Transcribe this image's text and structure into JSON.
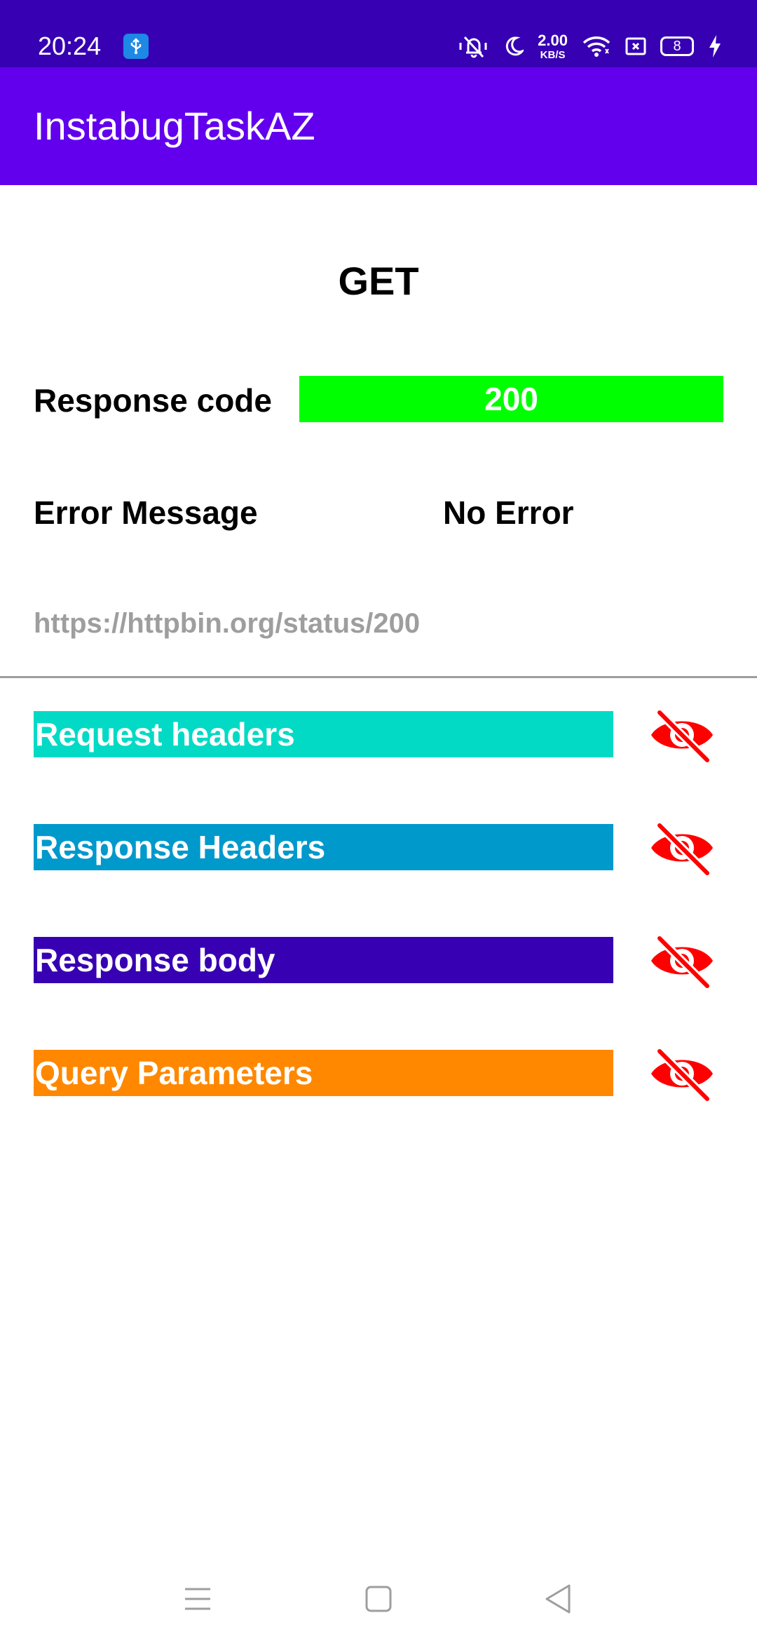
{
  "status_bar": {
    "time": "20:24",
    "net_speed_value": "2.00",
    "net_speed_unit": "KB/S",
    "battery_level": "8",
    "icons": [
      "usb-icon",
      "mute-icon",
      "moon-icon",
      "wifi-icon",
      "sim-icon",
      "battery-icon",
      "charging-icon"
    ]
  },
  "app_bar": {
    "title": "InstabugTaskAZ"
  },
  "request": {
    "method": "GET",
    "response_code_label": "Response code",
    "response_code_value": "200",
    "error_message_label": "Error Message",
    "error_message_value": "No Error",
    "url": "https://httpbin.org/status/200"
  },
  "sections": [
    {
      "label": "Request headers",
      "color": "#03dac5"
    },
    {
      "label": "Response Headers",
      "color": "#0099cc"
    },
    {
      "label": "Response body",
      "color": "#3700b3"
    },
    {
      "label": "Query Parameters",
      "color": "#ff8800"
    }
  ],
  "colors": {
    "status_bar": "#3700b3",
    "app_bar": "#6200ee",
    "response_code_bg": "#00ff00",
    "eye_icon": "#ff0000",
    "url_text": "#9e9e9e"
  },
  "nav_bar": {
    "icons": [
      "menu-icon",
      "home-icon",
      "back-icon"
    ]
  }
}
